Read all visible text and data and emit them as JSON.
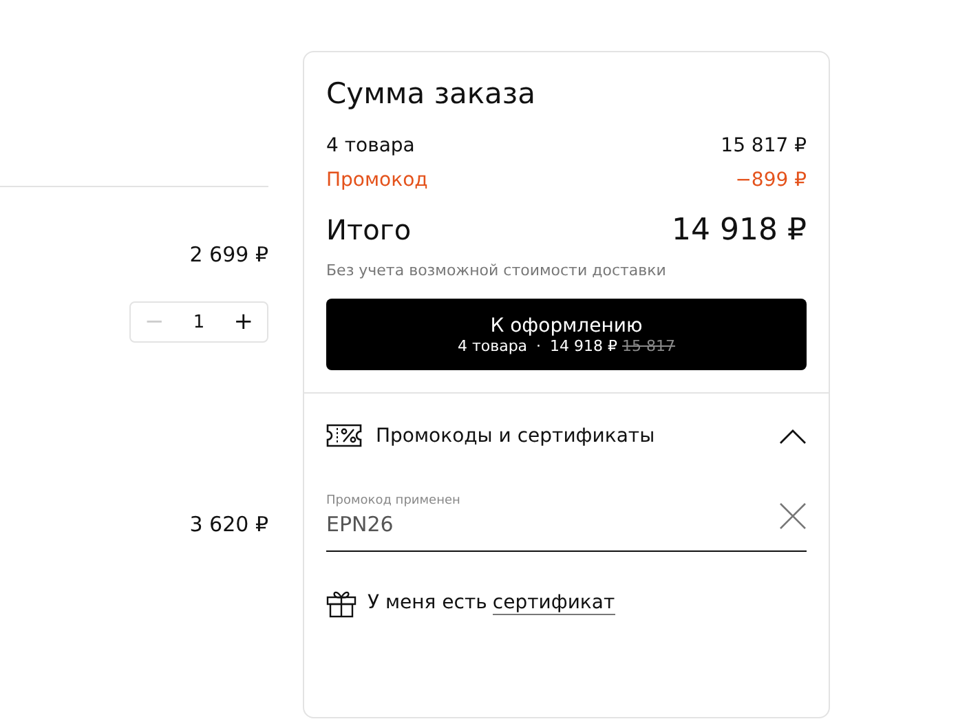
{
  "cart_items": [
    {
      "price": "2 699 ₽",
      "stepper": {
        "minus": "−",
        "quantity": "1",
        "plus": "+",
        "minus_disabled": true
      }
    },
    {
      "price": "3 620 ₽"
    }
  ],
  "summary": {
    "title": "Сумма заказа",
    "lines": [
      {
        "kind": "normal",
        "label": "4 товара",
        "value": "15 817 ₽"
      },
      {
        "kind": "discount",
        "label": "Промокод",
        "value": "−899 ₽"
      }
    ],
    "total": {
      "label": "Итого",
      "value": "14 918 ₽"
    },
    "note": "Без учета возможной стоимости доставки",
    "checkout_button": {
      "label": "К оформлению",
      "count": "4 товара",
      "separator": "·",
      "price": "14 918 ₽",
      "old_price": "15 817"
    },
    "promo_section": {
      "title": "Промокоды и сертификаты",
      "expanded": true,
      "promo_field": {
        "label": "Промокод применен",
        "value": "EPN26"
      },
      "certificate": {
        "text": "У меня есть",
        "link": "сертификат"
      }
    }
  }
}
